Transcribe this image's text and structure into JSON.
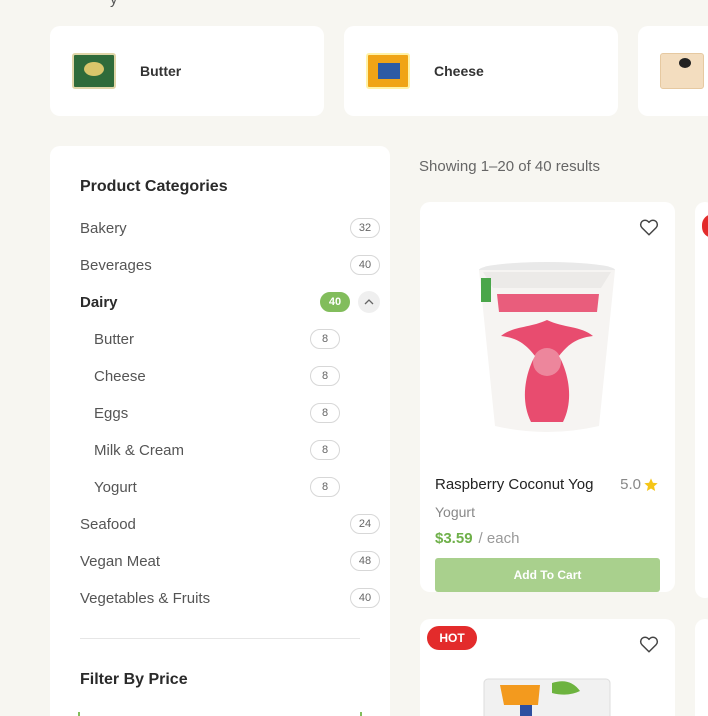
{
  "top_categories": [
    {
      "name": "Butter",
      "icon": "butter-product-icon"
    },
    {
      "name": "Cheese",
      "icon": "cheese-product-icon"
    },
    {
      "name": "",
      "icon": "eggs-product-icon"
    }
  ],
  "sidebar": {
    "categories_title": "Product Categories",
    "categories": [
      {
        "label": "Bakery",
        "count": "32"
      },
      {
        "label": "Beverages",
        "count": "40"
      },
      {
        "label": "Dairy",
        "count": "40",
        "active": true
      },
      {
        "label": "Butter",
        "count": "8"
      },
      {
        "label": "Cheese",
        "count": "8"
      },
      {
        "label": "Eggs",
        "count": "8"
      },
      {
        "label": "Milk & Cream",
        "count": "8"
      },
      {
        "label": "Yogurt",
        "count": "8"
      },
      {
        "label": "Seafood",
        "count": "24"
      },
      {
        "label": "Vegan Meat",
        "count": "48"
      },
      {
        "label": "Vegetables & Fruits",
        "count": "40"
      }
    ],
    "price_title": "Filter By Price"
  },
  "results_text": "Showing 1–20 of 40 results",
  "products": [
    {
      "name": "Raspberry Coconut Yog",
      "rating": "5.0",
      "category": "Yogurt",
      "price": "$3.59",
      "unit": "/ each",
      "button": "Add To Cart"
    },
    {
      "badge": "HOT"
    }
  ],
  "colors": {
    "accent_green": "#82bd5c",
    "button_green": "#a9d08d",
    "hot_red": "#e32b2b",
    "star": "#f5c518"
  }
}
